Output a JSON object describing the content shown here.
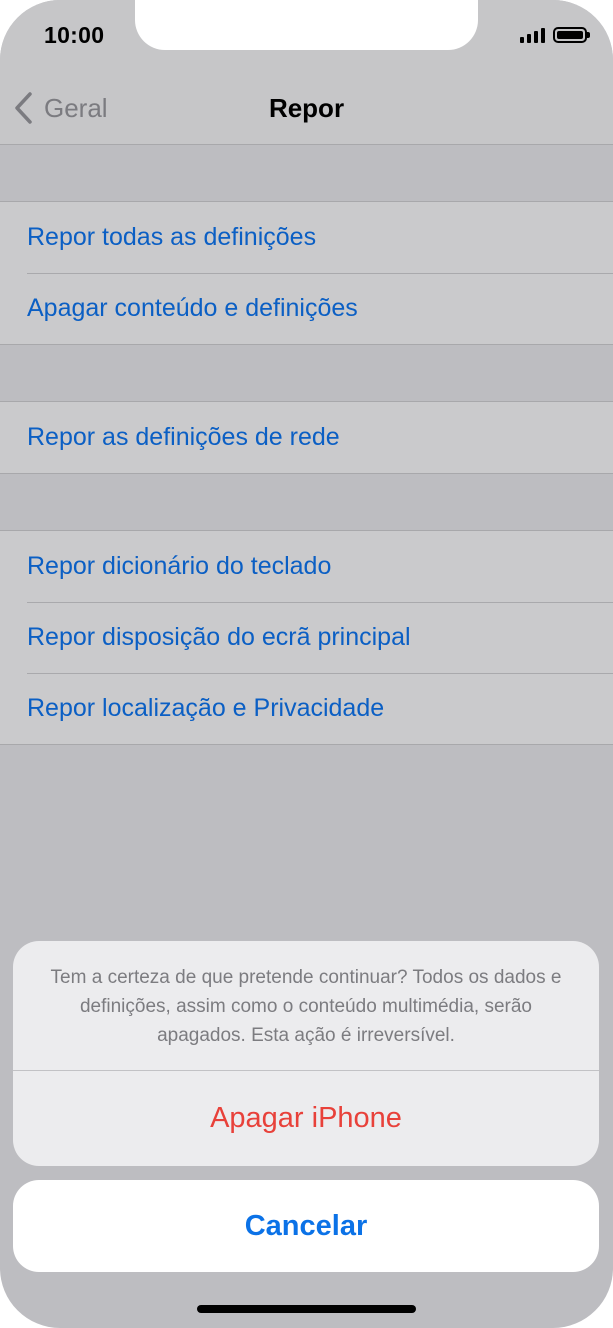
{
  "status_bar": {
    "time": "10:00"
  },
  "nav": {
    "back_label": "Geral",
    "title": "Repor"
  },
  "sections": [
    {
      "items": [
        {
          "label": "Repor todas as definições"
        },
        {
          "label": "Apagar conteúdo e definições"
        }
      ]
    },
    {
      "items": [
        {
          "label": "Repor as definições de rede"
        }
      ]
    },
    {
      "items": [
        {
          "label": "Repor dicionário do teclado"
        },
        {
          "label": "Repor disposição do ecrã principal"
        },
        {
          "label": "Repor localização e Privacidade"
        }
      ]
    }
  ],
  "action_sheet": {
    "message": "Tem a certeza de que pretende continuar? Todos os dados e definições, assim como o conteúdo multimédia, serão apagados. Esta ação é irreversível.",
    "destructive_label": "Apagar iPhone",
    "cancel_label": "Cancelar"
  },
  "colors": {
    "link": "#0b5fc4",
    "destructive": "#e8413a",
    "cancel": "#0b72e7"
  },
  "icons": {
    "back": "chevron-left-icon",
    "signal": "cellular-signal-icon",
    "battery": "battery-icon"
  }
}
